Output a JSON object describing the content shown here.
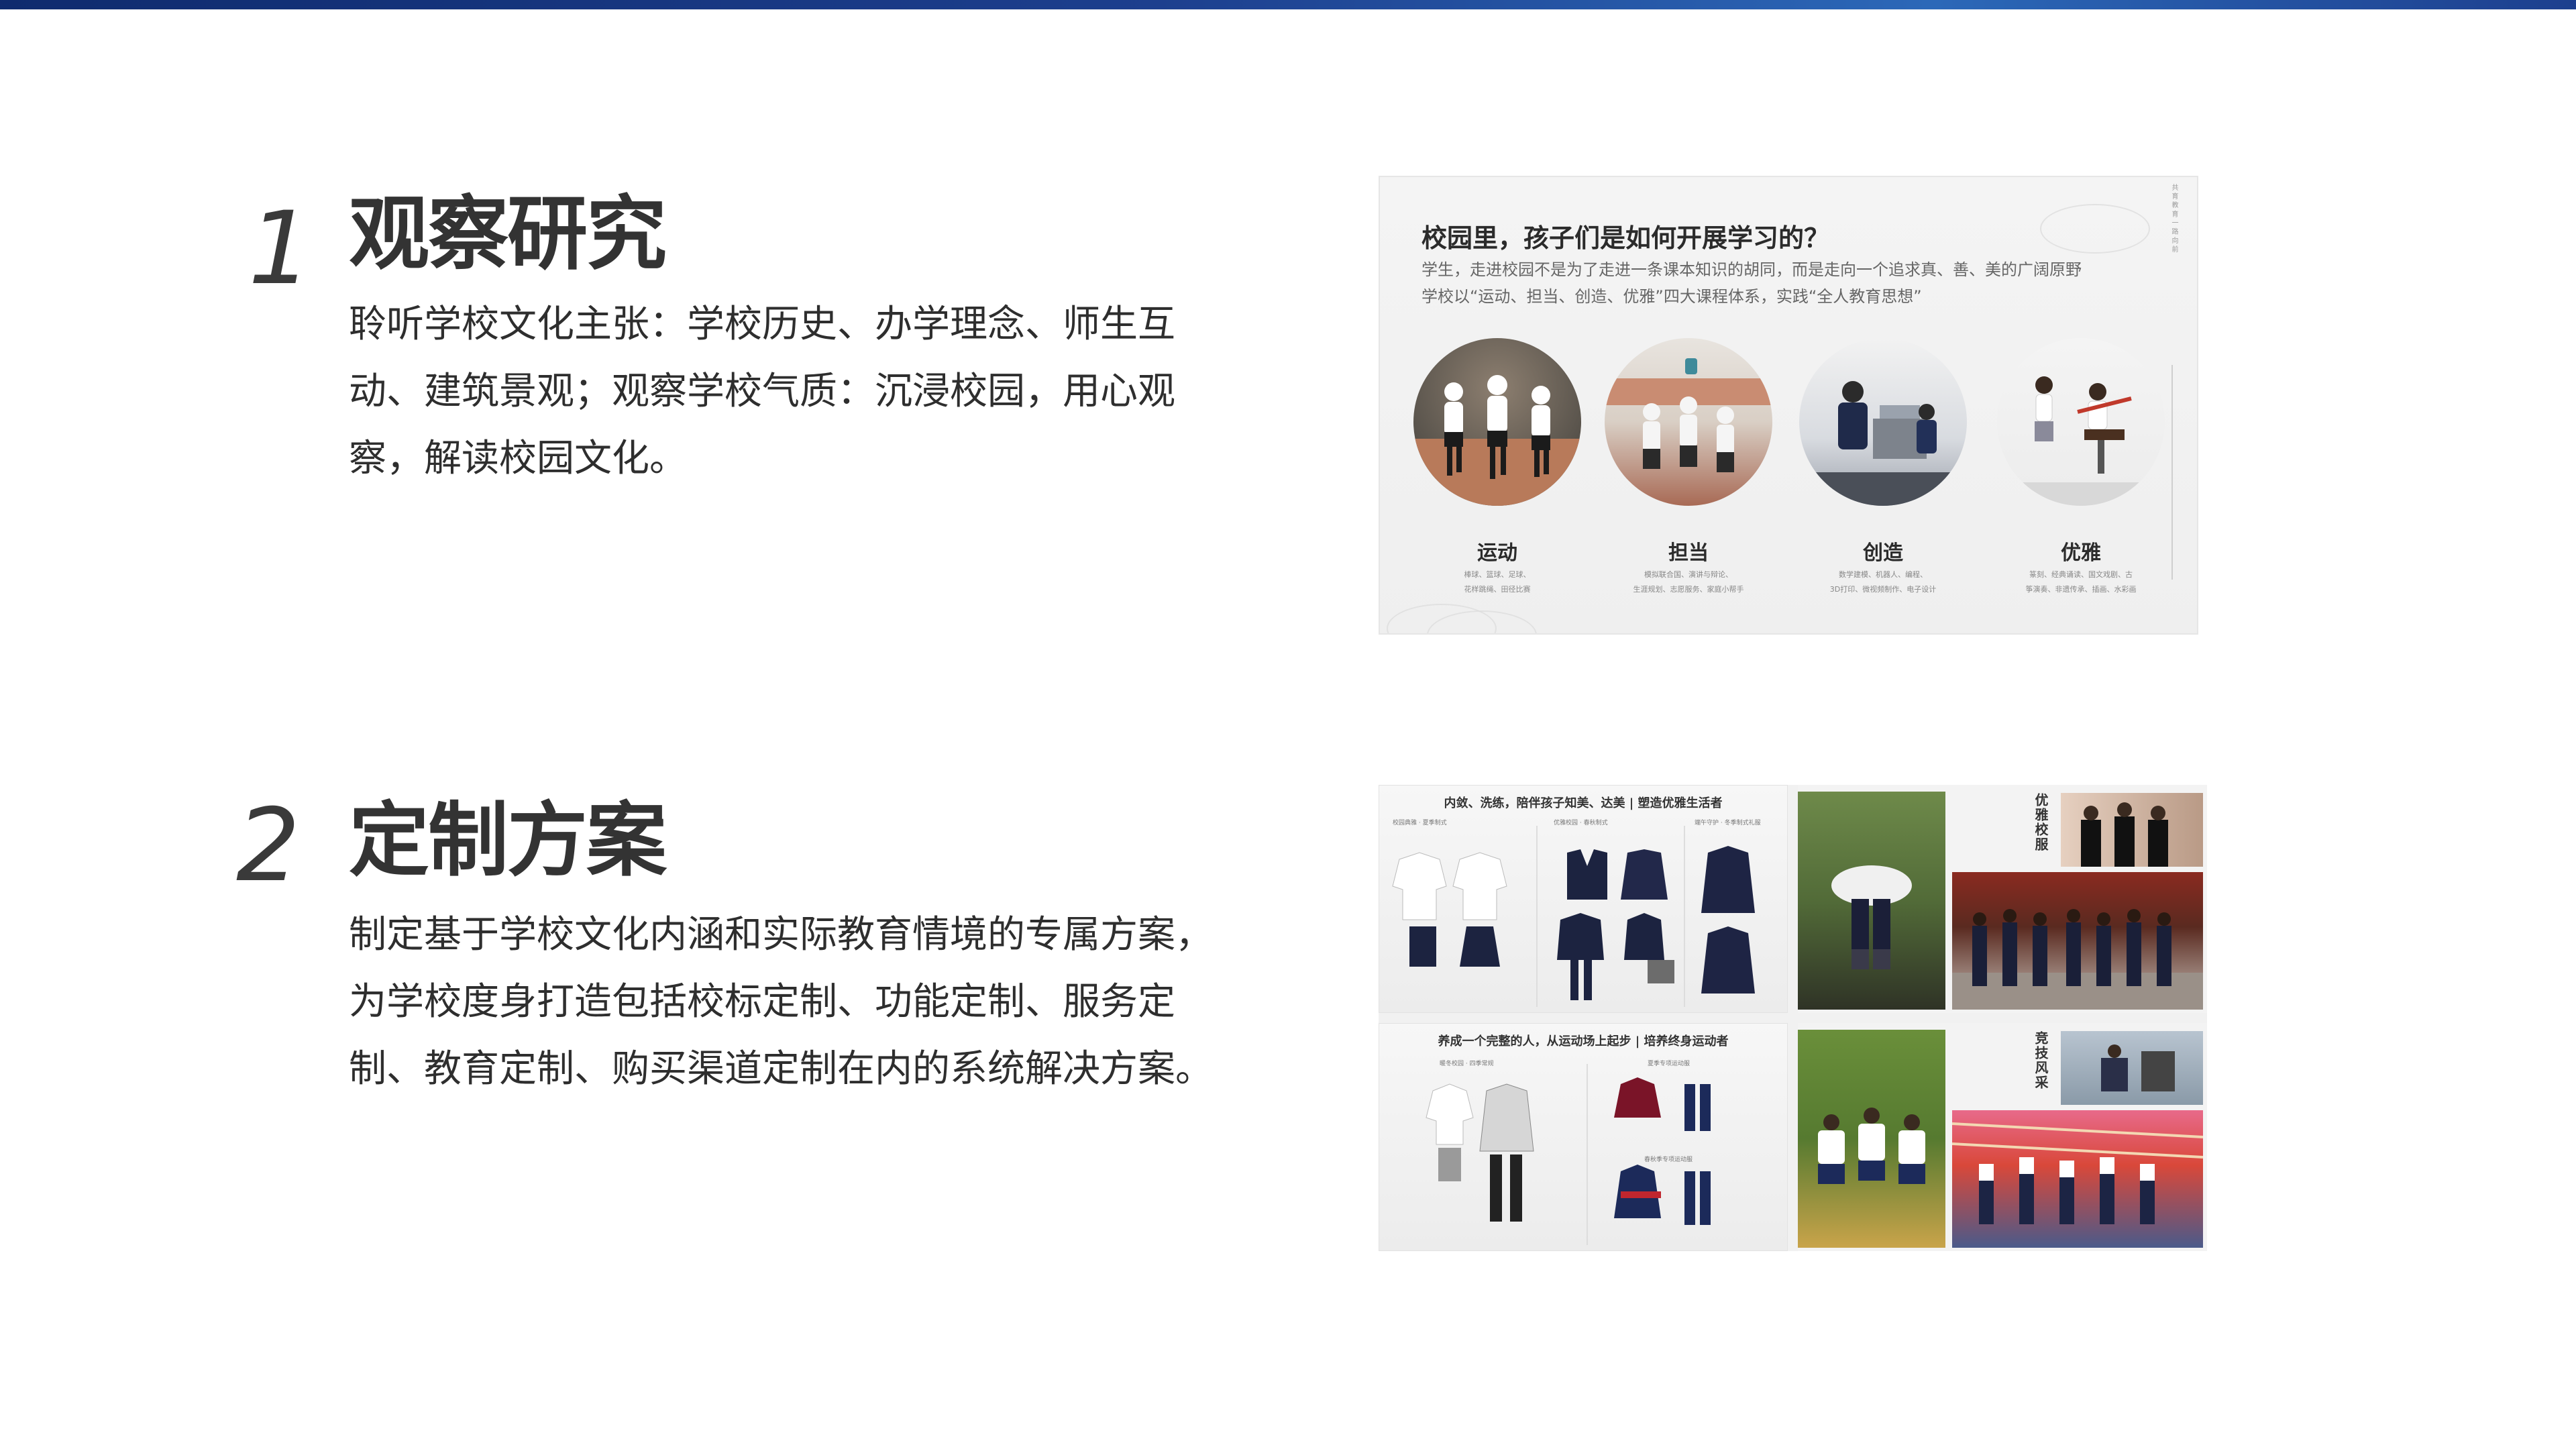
{
  "sections": [
    {
      "number": "1",
      "title": "观察研究",
      "body": "聆听学校文化主张：学校历史、办学理念、师生互动、建筑景观；观察学校气质：沉浸校园，用心观察，解读校园文化。"
    },
    {
      "number": "2",
      "title": "定制方案",
      "body": "制定基于学校文化内涵和实际教育情境的专属方案，为学校度身打造包括校标定制、功能定制、服务定制、教育定制、购买渠道定制在内的系统解决方案。"
    }
  ],
  "panel1": {
    "title": "校园里，孩子们是如何开展学习的？",
    "desc_line1": "学生，走进校园不是为了走进一条课本知识的胡同，而是走向一个追求真、善、美的广阔原野",
    "desc_line2": "学校以“运动、担当、创造、优雅”四大课程体系，实践“全人教育思想”",
    "side_text": "共 育 教 育 一 路 向 前",
    "circles": [
      {
        "caption": "运动",
        "sub1": "棒球、篮球、足球、",
        "sub2": "花样跳绳、田径比赛"
      },
      {
        "caption": "担当",
        "sub1": "模拟联合国、演讲与辩论、",
        "sub2": "生涯规划、志愿服务、家庭小帮手"
      },
      {
        "caption": "创造",
        "sub1": "数学建模、机器人、编程、",
        "sub2": "3D打印、微视频制作、电子设计"
      },
      {
        "caption": "优雅",
        "sub1": "篆刻、经典诵读、国文戏剧、古",
        "sub2": "筝演奏、非遗传承、插画、水彩画"
      }
    ]
  },
  "panel2": {
    "tile1_head": "内敛、洗练，陪伴孩子知美、达美 | 塑造优雅生活者",
    "tile1_labels": [
      "校园典雅 · 夏季制式",
      "优雅校园 · 春秋制式",
      "端午守护 · 冬季制式礼服"
    ],
    "tile2_vert": "优雅校服",
    "tile3_head": "养成一个完整的人，从运动场上起步 | 培养终身运动者",
    "tile3_labels": [
      "暖冬校园 · 四季常规",
      "夏季专项运动服",
      "春秋季专项运动服"
    ],
    "tile4_vert": "竞技风采"
  },
  "colors": {
    "topbar": "#1d3f8e",
    "title": "#333333",
    "body": "#2e2e2e"
  }
}
